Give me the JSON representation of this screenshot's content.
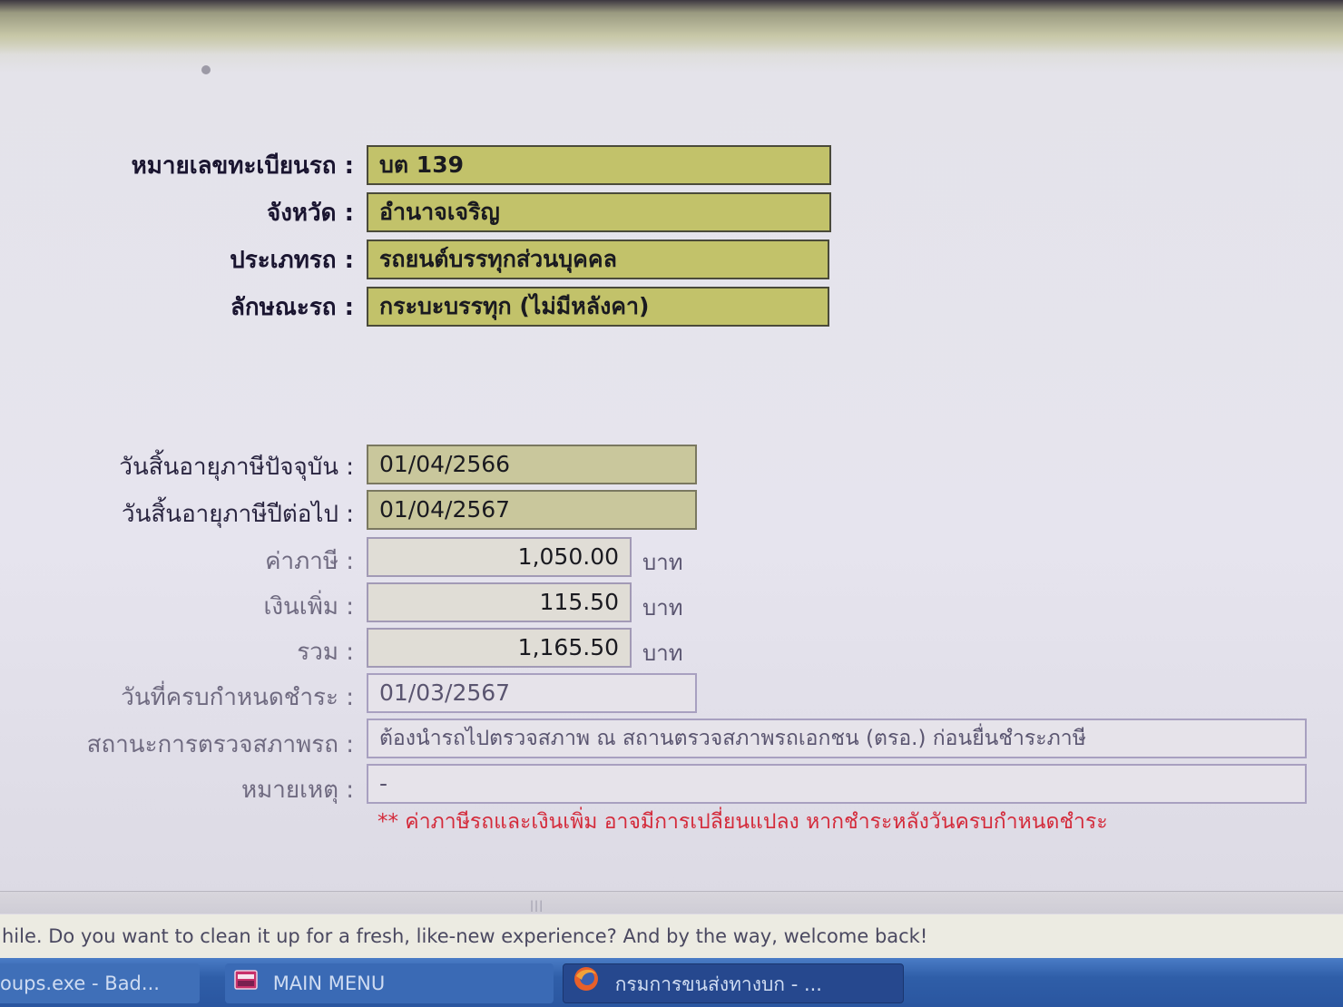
{
  "vehicle": {
    "plate_label": "หมายเลขทะเบียนรถ :",
    "plate_value": "บต 139",
    "province_label": "จังหวัด :",
    "province_value": "อำนาจเจริญ",
    "type_label": "ประเภทรถ :",
    "type_value": "รถยนต์บรรทุกส่วนบุคคล",
    "body_label": "ลักษณะรถ :",
    "body_value": "กระบะบรรทุก (ไม่มีหลังคา)"
  },
  "tax": {
    "current_expiry_label": "วันสิ้นอายุภาษีปัจจุบัน :",
    "current_expiry_value": "01/04/2566",
    "next_expiry_label": "วันสิ้นอายุภาษีปีต่อไป :",
    "next_expiry_value": "01/04/2567",
    "tax_label": "ค่าภาษี :",
    "tax_value": "1,050.00",
    "surcharge_label": "เงินเพิ่ม :",
    "surcharge_value": "115.50",
    "total_label": "รวม :",
    "total_value": "1,165.50",
    "unit": "บาท",
    "due_label": "วันที่ครบกำหนดชำระ :",
    "due_value": "01/03/2567",
    "inspection_label": "สถานะการตรวจสภาพรถ :",
    "inspection_value": "ต้องนำรถไปตรวจสภาพ ณ สถานตรวจสภาพรถเอกชน (ตรอ.) ก่อนยื่นชำระภาษี",
    "remark_label": "หมายเหตุ :",
    "remark_value": "-",
    "warning": "** ค่าภาษีรถและเงินเพิ่ม อาจมีการเปลี่ยนแปลง หากชำระหลังวันครบกำหนดชำระ"
  },
  "balloon": {
    "text": "hile. Do you want to clean it up for a fresh, like-new experience? And by the way, welcome back!"
  },
  "taskbar": {
    "items": [
      {
        "label": "oups.exe - Bad...",
        "icon": "error-app-icon"
      },
      {
        "label": "MAIN MENU",
        "icon": "app-window-icon"
      },
      {
        "label": "กรมการขนส่งทางบก - ...",
        "icon": "firefox-icon"
      }
    ]
  },
  "colors": {
    "olive_field": "#c2c26a",
    "khaki_field": "#c9c79c",
    "warning_red": "#d42a3a",
    "taskbar_blue": "#2f5ea8"
  }
}
